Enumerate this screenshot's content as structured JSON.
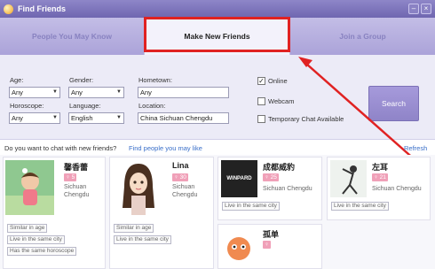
{
  "window": {
    "title": "Find Friends",
    "minimize": "–",
    "close": "×"
  },
  "tabs": [
    {
      "label": "People You May Know",
      "active": false
    },
    {
      "label": "Make New Friends",
      "active": true
    },
    {
      "label": "Join a Group",
      "active": false
    }
  ],
  "filters": {
    "age": {
      "label": "Age:",
      "value": "Any"
    },
    "gender": {
      "label": "Gender:",
      "value": "Any"
    },
    "hometown": {
      "label": "Hometown:",
      "value": "Any"
    },
    "horoscope": {
      "label": "Horoscope:",
      "value": "Any"
    },
    "language": {
      "label": "Language:",
      "value": "English"
    },
    "location": {
      "label": "Location:",
      "value": "China  Sichuan  Chengdu"
    },
    "online": {
      "label": "Online",
      "checked": true
    },
    "webcam": {
      "label": "Webcam",
      "checked": false
    },
    "temp_chat": {
      "label": "Temporary Chat Available",
      "checked": false
    },
    "search_label": "Search",
    "dropdown_glyph": "▼",
    "check_glyph": "✓"
  },
  "info": {
    "question": "Do you want to chat with new friends?",
    "find_link": "Find people you may like",
    "refresh": "Refresh"
  },
  "results": [
    {
      "name": "馨香蕾",
      "age": "♀ 5",
      "loc1": "Sichuan",
      "loc2": "Chengdu",
      "tags": [
        "Similar in age",
        "Live in the same city",
        "Has the same horoscope"
      ]
    },
    {
      "name": "Lina",
      "age": "♀ 30",
      "loc1": "Sichuan",
      "loc2": "Chengdu",
      "tags": [
        "Similar in age",
        "Live in the same city"
      ]
    },
    {
      "name": "成都威豹",
      "age": "♀ 25",
      "loc1": "Sichuan  Chengdu",
      "tags": [
        "Live in the same city"
      ],
      "photo_text": "WINPARD"
    },
    {
      "name": "左耳",
      "age": "♀ 21",
      "loc1": "Sichuan  Chengdu",
      "tags": [
        "Live in the same city"
      ]
    },
    {
      "name": "孤单",
      "age": "♀"
    }
  ],
  "colors": {
    "accent": "#7b70b6",
    "highlight": "#e02222",
    "link": "#3a6fc9",
    "badge": "#f0a0b8"
  }
}
